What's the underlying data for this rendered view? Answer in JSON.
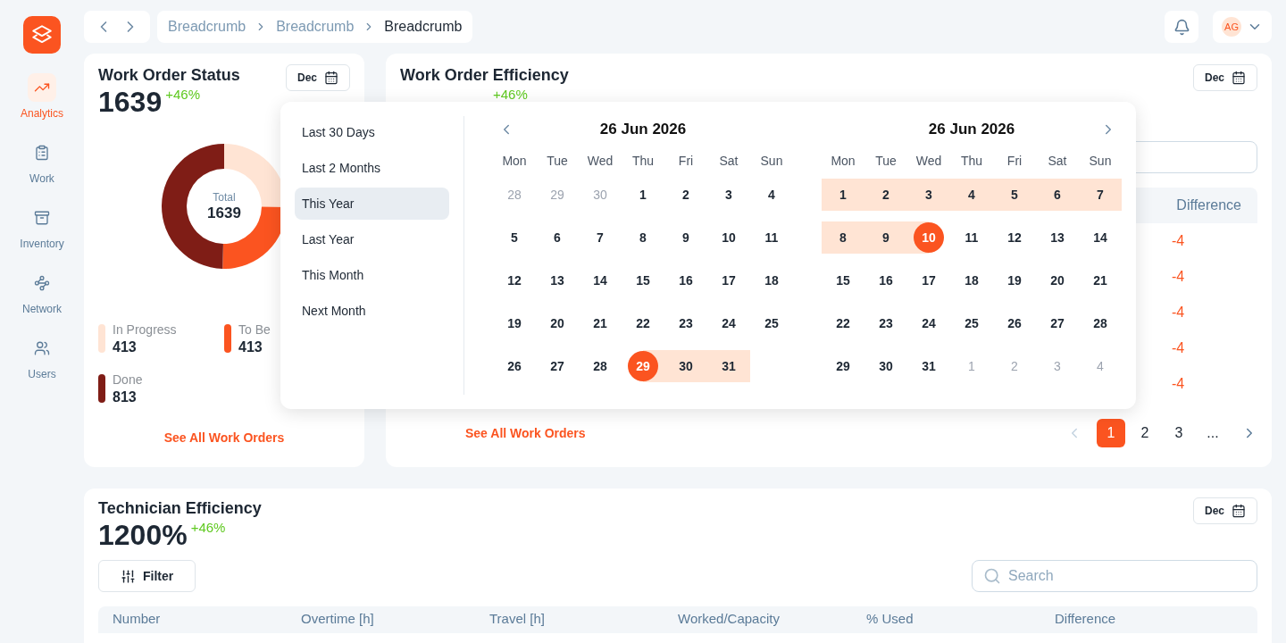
{
  "sidebar": {
    "items": [
      {
        "label": "Analytics",
        "selected": true
      },
      {
        "label": "Work",
        "selected": false
      },
      {
        "label": "Inventory",
        "selected": false
      },
      {
        "label": "Network",
        "selected": false
      },
      {
        "label": "Users",
        "selected": false
      }
    ]
  },
  "breadcrumb": [
    "Breadcrumb",
    "Breadcrumb",
    "Breadcrumb"
  ],
  "user": {
    "initials": "AG"
  },
  "status_card": {
    "title": "Work Order Status",
    "value": "1639",
    "change": "+46%",
    "period": "Dec",
    "center_label": "Total",
    "center_value": "1639",
    "chart_data": {
      "type": "donut",
      "categories": [
        "In Progress",
        "To Be",
        "Done"
      ],
      "values": [
        25.2,
        25.2,
        49.6
      ]
    },
    "legend": [
      {
        "value": "413",
        "color": "#ffe4d4"
      },
      {
        "value": "413",
        "color": "#fb5420"
      },
      {
        "value": "813",
        "color": "#7f1d16"
      }
    ],
    "link": "See All Work Orders"
  },
  "efficiency_card": {
    "title": "Work Order Efficiency",
    "change": "+46%",
    "period": "Dec",
    "column": "Difference",
    "rows": [
      "-4",
      "-4",
      "-4",
      "-4",
      "-4"
    ],
    "link": "See All Work Orders",
    "pages": [
      {
        "label": "1",
        "selected": true
      },
      {
        "label": "2",
        "selected": false
      },
      {
        "label": "3",
        "selected": false
      },
      {
        "label": "...",
        "selected": false
      }
    ]
  },
  "date_picker": {
    "presets": [
      {
        "label": "Last 30 Days",
        "selected": false
      },
      {
        "label": "Last 2 Months",
        "selected": false
      },
      {
        "label": "This Year",
        "selected": true
      },
      {
        "label": "Last Year",
        "selected": false
      },
      {
        "label": "This Month",
        "selected": false
      },
      {
        "label": "Next Month",
        "selected": false
      }
    ],
    "months": [
      {
        "title": "26 Jun 2026",
        "weekdays": [
          "Mon",
          "Tue",
          "Wed",
          "Thu",
          "Fri",
          "Sat",
          "Sun"
        ],
        "weeks": [
          [
            {
              "day": "28",
              "muted": true,
              "in_range": false,
              "range_start": false,
              "range_end": false
            },
            {
              "day": "29",
              "muted": true,
              "in_range": false,
              "range_start": false,
              "range_end": false
            },
            {
              "day": "30",
              "muted": true,
              "in_range": false,
              "range_start": false,
              "range_end": false
            },
            {
              "day": "1",
              "muted": false,
              "in_range": false,
              "range_start": false,
              "range_end": false
            },
            {
              "day": "2",
              "muted": false,
              "in_range": false,
              "range_start": false,
              "range_end": false
            },
            {
              "day": "3",
              "muted": false,
              "in_range": false,
              "range_start": false,
              "range_end": false
            },
            {
              "day": "4",
              "muted": false,
              "in_range": false,
              "range_start": false,
              "range_end": false
            }
          ],
          [
            {
              "day": "5",
              "muted": false,
              "in_range": false,
              "range_start": false,
              "range_end": false
            },
            {
              "day": "6",
              "muted": false,
              "in_range": false,
              "range_start": false,
              "range_end": false
            },
            {
              "day": "7",
              "muted": false,
              "in_range": false,
              "range_start": false,
              "range_end": false
            },
            {
              "day": "8",
              "muted": false,
              "in_range": false,
              "range_start": false,
              "range_end": false
            },
            {
              "day": "9",
              "muted": false,
              "in_range": false,
              "range_start": false,
              "range_end": false
            },
            {
              "day": "10",
              "muted": false,
              "in_range": false,
              "range_start": false,
              "range_end": false
            },
            {
              "day": "11",
              "muted": false,
              "in_range": false,
              "range_start": false,
              "range_end": false
            }
          ],
          [
            {
              "day": "12",
              "muted": false,
              "in_range": false,
              "range_start": false,
              "range_end": false
            },
            {
              "day": "13",
              "muted": false,
              "in_range": false,
              "range_start": false,
              "range_end": false
            },
            {
              "day": "14",
              "muted": false,
              "in_range": false,
              "range_start": false,
              "range_end": false
            },
            {
              "day": "15",
              "muted": false,
              "in_range": false,
              "range_start": false,
              "range_end": false
            },
            {
              "day": "16",
              "muted": false,
              "in_range": false,
              "range_start": false,
              "range_end": false
            },
            {
              "day": "17",
              "muted": false,
              "in_range": false,
              "range_start": false,
              "range_end": false
            },
            {
              "day": "18",
              "muted": false,
              "in_range": false,
              "range_start": false,
              "range_end": false
            }
          ],
          [
            {
              "day": "19",
              "muted": false,
              "in_range": false,
              "range_start": false,
              "range_end": false
            },
            {
              "day": "20",
              "muted": false,
              "in_range": false,
              "range_start": false,
              "range_end": false
            },
            {
              "day": "21",
              "muted": false,
              "in_range": false,
              "range_start": false,
              "range_end": false
            },
            {
              "day": "22",
              "muted": false,
              "in_range": false,
              "range_start": false,
              "range_end": false
            },
            {
              "day": "23",
              "muted": false,
              "in_range": false,
              "range_start": false,
              "range_end": false
            },
            {
              "day": "24",
              "muted": false,
              "in_range": false,
              "range_start": false,
              "range_end": false
            },
            {
              "day": "25",
              "muted": false,
              "in_range": false,
              "range_start": false,
              "range_end": false
            }
          ],
          [
            {
              "day": "26",
              "muted": false,
              "in_range": false,
              "range_start": false,
              "range_end": false
            },
            {
              "day": "27",
              "muted": false,
              "in_range": false,
              "range_start": false,
              "range_end": false
            },
            {
              "day": "28",
              "muted": false,
              "in_range": false,
              "range_start": false,
              "range_end": false
            },
            {
              "day": "29",
              "muted": false,
              "in_range": true,
              "range_start": true,
              "range_end": false
            },
            {
              "day": "30",
              "muted": false,
              "in_range": true,
              "range_start": false,
              "range_end": false
            },
            {
              "day": "31",
              "muted": false,
              "in_range": true,
              "range_start": false,
              "range_end": false
            }
          ]
        ]
      },
      {
        "title": "26 Jun 2026",
        "weekdays": [
          "Mon",
          "Tue",
          "Wed",
          "Thu",
          "Fri",
          "Sat",
          "Sun"
        ],
        "weeks": [
          [
            {
              "day": "1",
              "muted": false,
              "in_range": true,
              "range_start": false,
              "range_end": false
            },
            {
              "day": "2",
              "muted": false,
              "in_range": true,
              "range_start": false,
              "range_end": false
            },
            {
              "day": "3",
              "muted": false,
              "in_range": true,
              "range_start": false,
              "range_end": false
            },
            {
              "day": "4",
              "muted": false,
              "in_range": true,
              "range_start": false,
              "range_end": false
            },
            {
              "day": "5",
              "muted": false,
              "in_range": true,
              "range_start": false,
              "range_end": false
            },
            {
              "day": "6",
              "muted": false,
              "in_range": true,
              "range_start": false,
              "range_end": false
            },
            {
              "day": "7",
              "muted": false,
              "in_range": true,
              "range_start": false,
              "range_end": false
            }
          ],
          [
            {
              "day": "8",
              "muted": false,
              "in_range": true,
              "range_start": false,
              "range_end": false
            },
            {
              "day": "9",
              "muted": false,
              "in_range": true,
              "range_start": false,
              "range_end": false
            },
            {
              "day": "10",
              "muted": false,
              "in_range": true,
              "range_start": false,
              "range_end": true
            },
            {
              "day": "11",
              "muted": false,
              "in_range": false,
              "range_start": false,
              "range_end": false
            },
            {
              "day": "12",
              "muted": false,
              "in_range": false,
              "range_start": false,
              "range_end": false
            },
            {
              "day": "13",
              "muted": false,
              "in_range": false,
              "range_start": false,
              "range_end": false
            },
            {
              "day": "14",
              "muted": false,
              "in_range": false,
              "range_start": false,
              "range_end": false
            }
          ],
          [
            {
              "day": "15",
              "muted": false,
              "in_range": false,
              "range_start": false,
              "range_end": false
            },
            {
              "day": "16",
              "muted": false,
              "in_range": false,
              "range_start": false,
              "range_end": false
            },
            {
              "day": "17",
              "muted": false,
              "in_range": false,
              "range_start": false,
              "range_end": false
            },
            {
              "day": "18",
              "muted": false,
              "in_range": false,
              "range_start": false,
              "range_end": false
            },
            {
              "day": "19",
              "muted": false,
              "in_range": false,
              "range_start": false,
              "range_end": false
            },
            {
              "day": "20",
              "muted": false,
              "in_range": false,
              "range_start": false,
              "range_end": false
            },
            {
              "day": "21",
              "muted": false,
              "in_range": false,
              "range_start": false,
              "range_end": false
            }
          ],
          [
            {
              "day": "22",
              "muted": false,
              "in_range": false,
              "range_start": false,
              "range_end": false
            },
            {
              "day": "23",
              "muted": false,
              "in_range": false,
              "range_start": false,
              "range_end": false
            },
            {
              "day": "24",
              "muted": false,
              "in_range": false,
              "range_start": false,
              "range_end": false
            },
            {
              "day": "25",
              "muted": false,
              "in_range": false,
              "range_start": false,
              "range_end": false
            },
            {
              "day": "26",
              "muted": false,
              "in_range": false,
              "range_start": false,
              "range_end": false
            },
            {
              "day": "27",
              "muted": false,
              "in_range": false,
              "range_start": false,
              "range_end": false
            },
            {
              "day": "28",
              "muted": false,
              "in_range": false,
              "range_start": false,
              "range_end": false
            }
          ],
          [
            {
              "day": "29",
              "muted": false,
              "in_range": false,
              "range_start": false,
              "range_end": false
            },
            {
              "day": "30",
              "muted": false,
              "in_range": false,
              "range_start": false,
              "range_end": false
            },
            {
              "day": "31",
              "muted": false,
              "in_range": false,
              "range_start": false,
              "range_end": false
            },
            {
              "day": "1",
              "muted": true,
              "in_range": false,
              "range_start": false,
              "range_end": false
            },
            {
              "day": "2",
              "muted": true,
              "in_range": false,
              "range_start": false,
              "range_end": false
            },
            {
              "day": "3",
              "muted": true,
              "in_range": false,
              "range_start": false,
              "range_end": false
            },
            {
              "day": "4",
              "muted": true,
              "in_range": false,
              "range_start": false,
              "range_end": false
            }
          ]
        ]
      }
    ]
  },
  "technician_card": {
    "title": "Technician Efficiency",
    "value": "1200%",
    "change": "+46%",
    "period": "Dec",
    "filter": "Filter",
    "search": {
      "placeholder": "Search"
    },
    "table": {
      "columns": [
        "Number",
        "Overtime [h]",
        "Travel [h]",
        "Worked/Capacity",
        "% Used",
        "Difference"
      ]
    }
  }
}
